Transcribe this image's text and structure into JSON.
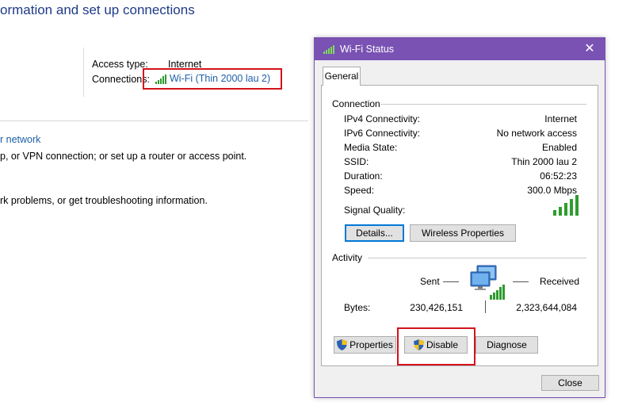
{
  "background": {
    "title": "ormation and set up connections",
    "access_type_label": "Access type:",
    "access_type_value": "Internet",
    "connections_label": "Connections:",
    "connection_link": "Wi-Fi (Thin 2000 lau 2)",
    "network_link": "r network",
    "setup_text": "p, or VPN connection; or set up a router or access point.",
    "troubleshoot_text": "rk problems, or get troubleshooting information."
  },
  "dialog": {
    "title": "Wi-Fi Status",
    "close_glyph": "✕",
    "tab_general": "General",
    "connection_group": "Connection",
    "fields": [
      {
        "label": "IPv4 Connectivity:",
        "value": "Internet"
      },
      {
        "label": "IPv6 Connectivity:",
        "value": "No network access"
      },
      {
        "label": "Media State:",
        "value": "Enabled"
      },
      {
        "label": "SSID:",
        "value": "Thin 2000 lau 2"
      },
      {
        "label": "Duration:",
        "value": "06:52:23"
      },
      {
        "label": "Speed:",
        "value": "300.0 Mbps"
      }
    ],
    "signal_quality_label": "Signal Quality:",
    "details_button": "Details...",
    "wireless_properties_button": "Wireless Properties",
    "activity_group": "Activity",
    "sent_label": "Sent",
    "received_label": "Received",
    "bytes_label": "Bytes:",
    "bytes_sent": "230,426,151",
    "bytes_received": "2,323,644,084",
    "properties_button": "Properties",
    "disable_button": "Disable",
    "diagnose_button": "Diagnose",
    "close_button": "Close"
  },
  "colors": {
    "titlebar": "#7952b3",
    "highlight_box": "#d4121a",
    "link": "#1e5fa8",
    "signal_green": "#2e9c2e"
  }
}
